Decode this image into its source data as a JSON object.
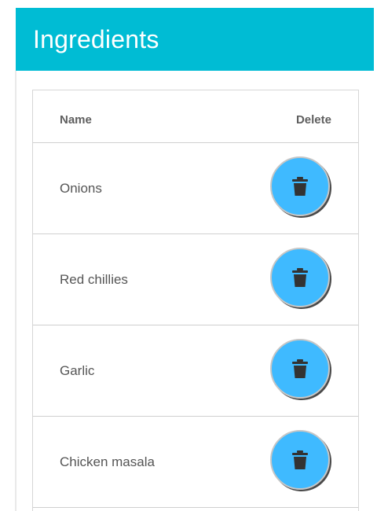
{
  "header": {
    "title": "Ingredients"
  },
  "table": {
    "columns": {
      "name": "Name",
      "delete": "Delete"
    },
    "rows": [
      {
        "name": "Onions",
        "delete_icon": "trash-icon"
      },
      {
        "name": "Red chillies",
        "delete_icon": "trash-icon"
      },
      {
        "name": "Garlic",
        "delete_icon": "trash-icon"
      },
      {
        "name": "Chicken masala",
        "delete_icon": "trash-icon"
      }
    ]
  },
  "colors": {
    "header_bg": "#00bcd4",
    "button_bg": "#3fbaff",
    "icon": "#333333"
  }
}
